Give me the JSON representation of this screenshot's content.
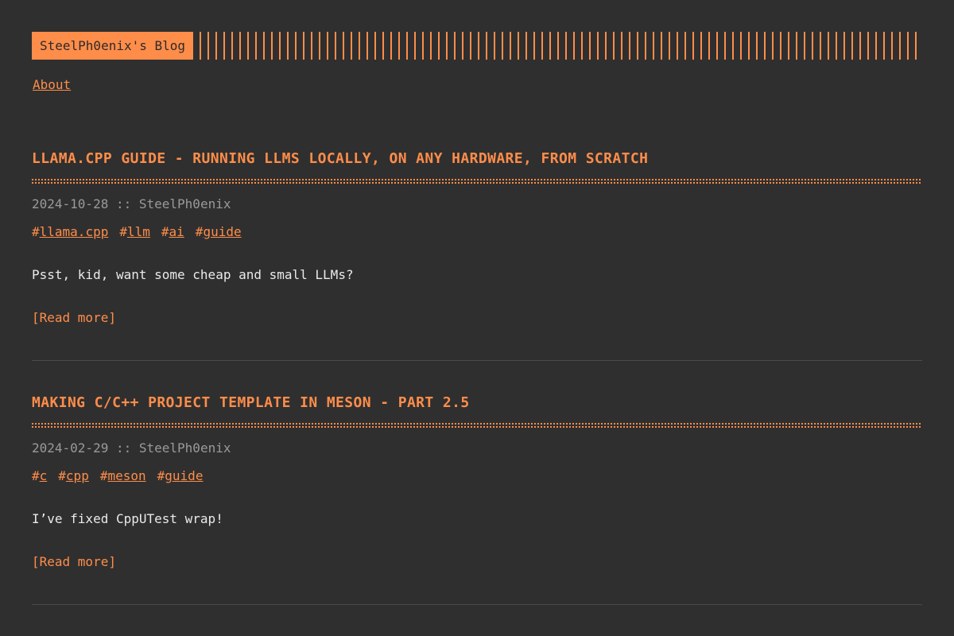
{
  "header": {
    "logo_text": "SteelPh0enix's Blog"
  },
  "nav": {
    "items": [
      {
        "label": "About"
      }
    ]
  },
  "posts": [
    {
      "title": "llama.cpp guide - running LLMs locally, on any hardware, from scratch",
      "date": "2024-10-28",
      "separator": "::",
      "author": "SteelPh0enix",
      "tags": [
        "llama.cpp",
        "llm",
        "ai",
        "guide"
      ],
      "excerpt": "Psst, kid, want some cheap and small LLMs?",
      "read_more": "[Read more]"
    },
    {
      "title": "Making C/C++ project template in Meson - part 2.5",
      "date": "2024-02-29",
      "separator": "::",
      "author": "SteelPh0enix",
      "tags": [
        "c",
        "cpp",
        "meson",
        "guide"
      ],
      "excerpt": "I’ve fixed CppUTest wrap!",
      "read_more": "[Read more]"
    }
  ],
  "colors": {
    "background": "#2f2f2f",
    "accent": "#ff8d4a",
    "meta_text": "#9a9a9a",
    "body_text": "#eaeaea",
    "divider": "#4a4a4a"
  }
}
